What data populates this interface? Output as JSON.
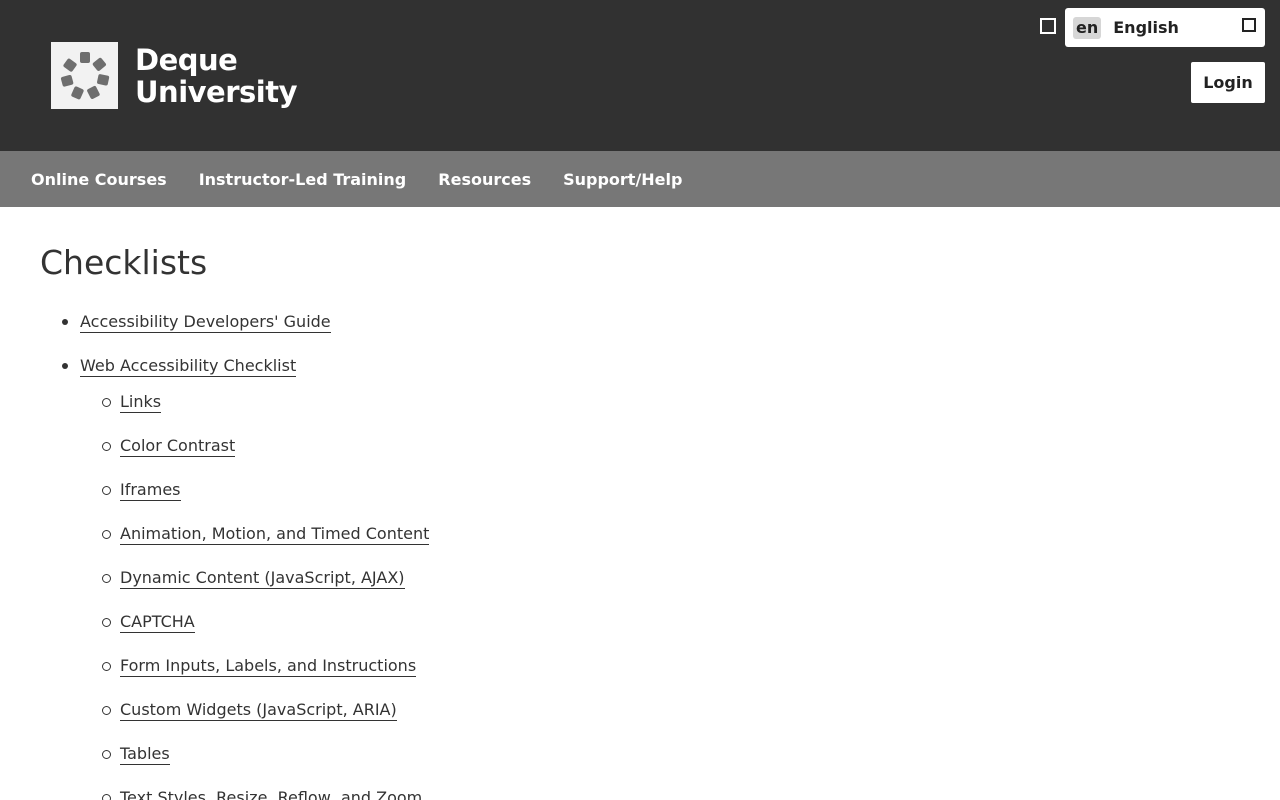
{
  "header": {
    "logo": {
      "line1": "Deque",
      "line2": "University"
    },
    "language": {
      "code": "en",
      "name": "English"
    },
    "login_label": "Login"
  },
  "nav": {
    "items": [
      {
        "label": "Online Courses"
      },
      {
        "label": "Instructor-Led Training"
      },
      {
        "label": "Resources"
      },
      {
        "label": "Support/Help"
      }
    ]
  },
  "main": {
    "title": "Checklists",
    "items": [
      {
        "label": "Accessibility Developers' Guide"
      },
      {
        "label": "Web Accessibility Checklist",
        "children": [
          {
            "label": "Links"
          },
          {
            "label": "Color Contrast"
          },
          {
            "label": "Iframes"
          },
          {
            "label": "Animation, Motion, and Timed Content"
          },
          {
            "label": "Dynamic Content (JavaScript, AJAX)"
          },
          {
            "label": "CAPTCHA"
          },
          {
            "label": "Form Inputs, Labels, and Instructions"
          },
          {
            "label": "Custom Widgets (JavaScript, ARIA)"
          },
          {
            "label": "Tables"
          },
          {
            "label": "Text Styles, Resize, Reflow, and Zoom"
          }
        ]
      }
    ]
  },
  "colors": {
    "header_bg": "#313131",
    "nav_bg": "#777777",
    "logo_mark": "#6e6e6e"
  }
}
